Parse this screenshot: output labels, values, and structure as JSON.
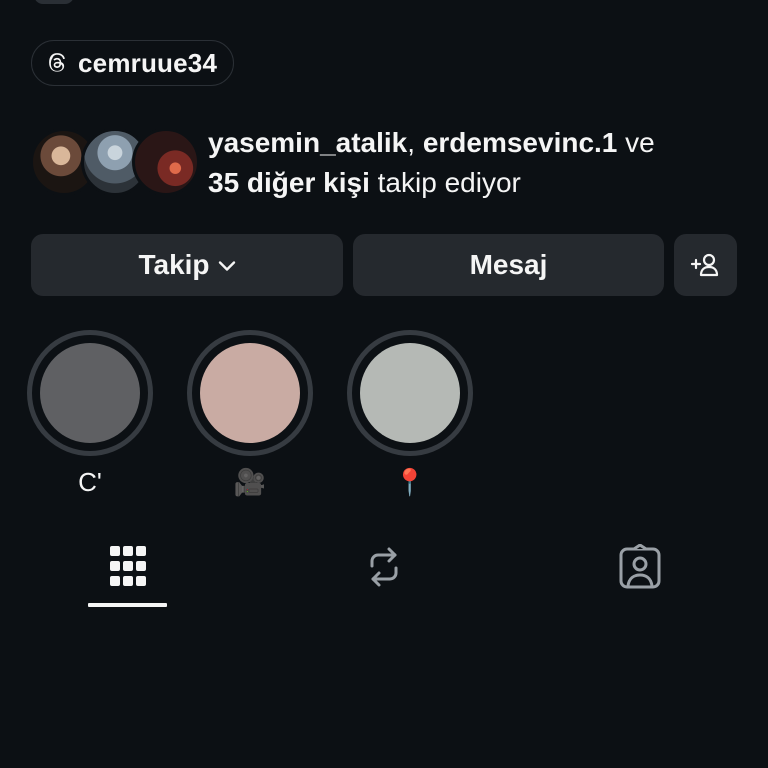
{
  "threads_badge": {
    "icon": "threads-icon",
    "username": "cemruue34"
  },
  "mutual_followers": {
    "user1": "yasemin_atalik",
    "separator": ",",
    "user2": "erdemsevinc.1",
    "conjunction": "ve",
    "others": "35 diğer kişi",
    "suffix": "takip ediyor"
  },
  "actions": {
    "follow_label": "Takip",
    "follow_icon": "chevron-down-icon",
    "message_label": "Mesaj",
    "add_user_icon": "add-person-icon"
  },
  "highlights": [
    {
      "label": "C'",
      "color": "#5f6063"
    },
    {
      "label": "🎥",
      "color": "#c9aba3"
    },
    {
      "label": "📍",
      "color": "#b5b9b5"
    }
  ],
  "tabs": [
    {
      "icon": "grid-icon",
      "active": true
    },
    {
      "icon": "reposts-icon",
      "active": false
    },
    {
      "icon": "tagged-icon",
      "active": false
    }
  ],
  "colors": {
    "background": "#0c1014",
    "button": "#25292e",
    "ring": "#363b41",
    "text": "#f5f5f5"
  }
}
